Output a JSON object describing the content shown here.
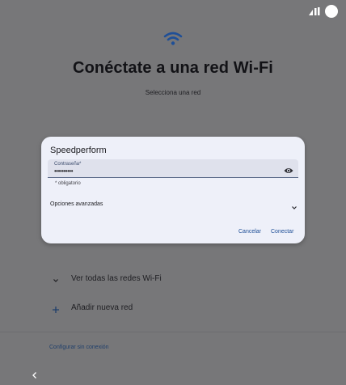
{
  "status_bar": {
    "signal_icon": "signal-icon",
    "battery_icon": "battery-icon"
  },
  "header": {
    "wifi_icon": "wifi-icon",
    "title": "Conéctate a una red Wi-Fi",
    "subtitle": "Selecciona una red"
  },
  "dialog": {
    "title": "Speedperform",
    "password": {
      "label": "Contraseña*",
      "value": "••••••••••",
      "toggle_icon": "eye-icon",
      "helper": "* obligatorio"
    },
    "advanced_label": "Opciones avanzadas",
    "cancel_label": "Cancelar",
    "connect_label": "Conectar"
  },
  "list": {
    "show_all_label": "Ver todas las redes Wi-Fi",
    "add_network_label": "Añadir nueva red"
  },
  "footer": {
    "offline_label": "Configurar sin conexión"
  },
  "colors": {
    "scrim_background": "#777779",
    "dialog_background": "#eef0f9",
    "accent": "#1f4f97",
    "wifi_icon": "#1f4f97"
  }
}
